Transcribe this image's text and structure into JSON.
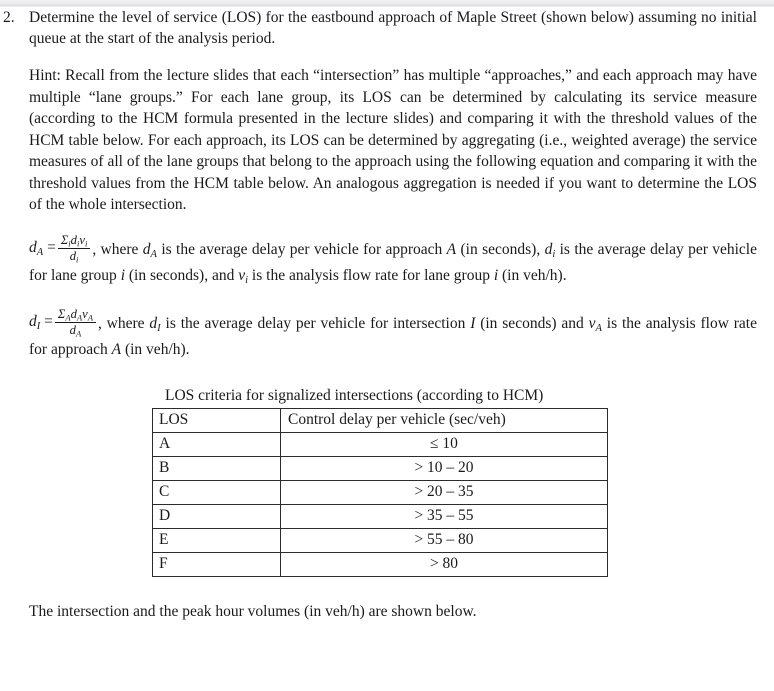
{
  "question": {
    "number": "2.",
    "prompt": "Determine the level of service (LOS) for the eastbound approach of Maple Street (shown below) assuming no initial queue at the start of the analysis period.",
    "hint": "Hint: Recall from the lecture slides that each “intersection” has multiple “approaches,” and each approach may have multiple “lane groups.” For each lane group, its LOS can be determined by calculating its service measure (according to the HCM formula presented in the lecture slides) and comparing it with the threshold values of the HCM table below. For each approach, its LOS can be determined by aggregating (i.e., weighted average) the service measures of all of the lane groups that belong to the approach using the following equation and comparing it with the threshold values from the HCM table below. An analogous aggregation is needed if you want to determine the LOS of the whole intersection."
  },
  "equations": {
    "approach": {
      "lhs_var": "d",
      "lhs_sub": "A",
      "equals": "=",
      "numerator": "Σ",
      "numerator_sub": "i",
      "numerator_rest_1": "d",
      "numerator_rest_1_sub": "i",
      "numerator_rest_2": "v",
      "numerator_rest_2_sub": "i",
      "denominator": "d",
      "denominator_sub": "i",
      "text_part_1": ", where ",
      "text_part_2": " is the average delay per vehicle for approach ",
      "approach_symbol": "A",
      "text_part_3": " (in seconds), ",
      "text_part_4": " is the average delay per vehicle for lane group ",
      "group_symbol": "i",
      "text_part_5": " (in seconds), and ",
      "text_part_6": " is the analysis flow rate for lane group ",
      "text_part_7": " (in veh/h)."
    },
    "intersection": {
      "lhs_var": "d",
      "lhs_sub": "I",
      "equals": "=",
      "numerator": "Σ",
      "numerator_sub": "A",
      "numerator_rest_1": "d",
      "numerator_rest_1_sub": "A",
      "numerator_rest_2": "v",
      "numerator_rest_2_sub": "A",
      "denominator": "d",
      "denominator_sub": "A",
      "text_part_1": ", where ",
      "text_part_2": " is the average delay per vehicle for intersection ",
      "intersection_symbol": "I",
      "text_part_3": " (in seconds) and ",
      "text_part_4": " is the analysis flow rate for approach ",
      "approach_symbol": "A",
      "text_part_5": " (in veh/h)."
    }
  },
  "table": {
    "caption": "LOS criteria for signalized intersections (according to HCM)",
    "headers": [
      "LOS",
      "Control delay per vehicle (sec/veh)"
    ],
    "rows": [
      {
        "los": "A",
        "delay": "≤ 10"
      },
      {
        "los": "B",
        "delay": "> 10 – 20"
      },
      {
        "los": "C",
        "delay": "> 20 – 35"
      },
      {
        "los": "D",
        "delay": "> 35 – 55"
      },
      {
        "los": "E",
        "delay": "> 55 – 80"
      },
      {
        "los": "F",
        "delay": "> 80"
      }
    ]
  },
  "closing": "The intersection and the peak hour volumes (in veh/h) are shown below."
}
